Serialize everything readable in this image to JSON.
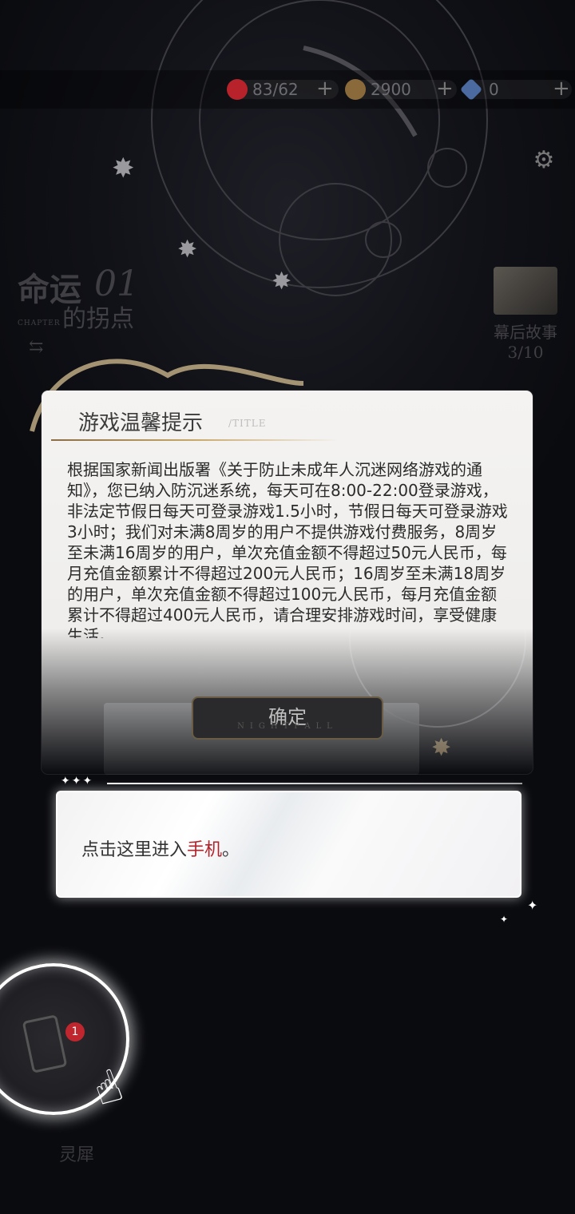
{
  "resources": [
    {
      "icon": "heart-gem-icon",
      "value": "83/62",
      "color": "#b8232b"
    },
    {
      "icon": "coin-icon",
      "value": "2900",
      "color": "#8a6a3a"
    },
    {
      "icon": "diamond-icon",
      "value": "0",
      "color": "#4a6aa0"
    }
  ],
  "plus_symbol": "+",
  "settings_icon": "gear-icon",
  "chapter": {
    "big": "命运",
    "num": "01",
    "small": "的拐点",
    "sub": "CHAPTER"
  },
  "story": {
    "label": "幕后故事",
    "progress": "3/10"
  },
  "dialog": {
    "title": "游戏温馨提示",
    "title_sub": "/TITLE",
    "body": "根据国家新闻出版署《关于防止未成年人沉迷网络游戏的通知》，您已纳入防沉迷系统，每天可在8:00-22:00登录游戏，非法定节假日每天可登录游戏1.5小时，节假日每天可登录游戏3小时；我们对未满8周岁的用户不提供游戏付费服务，8周岁至未满16周岁的用户，单次充值金额不得超过50元人民币，每月充值金额累计不得超过200元人民币；16周岁至未满18周岁的用户，单次充值金额不得超过100元人民币，每月充值金额累计不得超过400元人民币，请合理安排游戏时间，享受健康生活。",
    "confirm": "确定",
    "confirm_en": "NIGHTFALL"
  },
  "guide": {
    "stars": "✦✦✦",
    "text_before": "点击这里进入",
    "text_highlight": "手机",
    "text_after": "。"
  },
  "phone": {
    "badge": "1",
    "label": "灵犀"
  }
}
